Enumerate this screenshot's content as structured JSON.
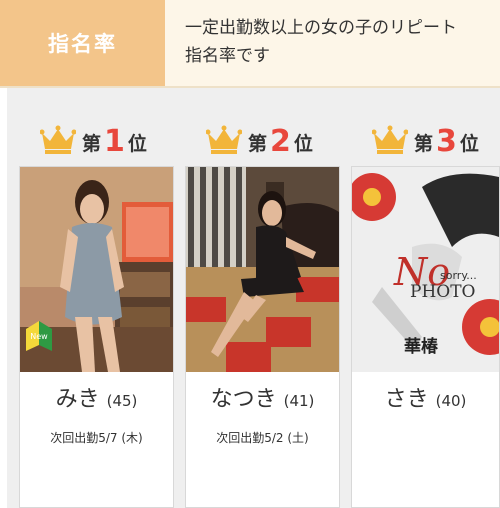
{
  "header": {
    "tab_label": "指名率",
    "description": [
      "一定出勤数以上の女の子のリピート",
      "指名率です"
    ]
  },
  "ranking": [
    {
      "rank_prefix": "第",
      "rank_number": "1",
      "rank_suffix": "位",
      "name": "みき",
      "age": "(45)",
      "next_work": "次回出勤5/7 (木)",
      "badge": "beginner-mark-icon"
    },
    {
      "rank_prefix": "第",
      "rank_number": "2",
      "rank_suffix": "位",
      "name": "なつき",
      "age": "(41)",
      "next_work": "次回出勤5/2 (土)"
    },
    {
      "rank_prefix": "第",
      "rank_number": "3",
      "rank_suffix": "位",
      "name": "さき",
      "age": "(40)",
      "next_work": "",
      "photo_text": {
        "main": "No",
        "sub": "sorry...",
        "label": "PHOTO",
        "shop": "華椿"
      }
    }
  ],
  "colors": {
    "tab_bg": "#f3c58a",
    "desc_bg": "#fdf6e8",
    "rank_number": "#e8473c",
    "crown": "#f2b53a"
  }
}
